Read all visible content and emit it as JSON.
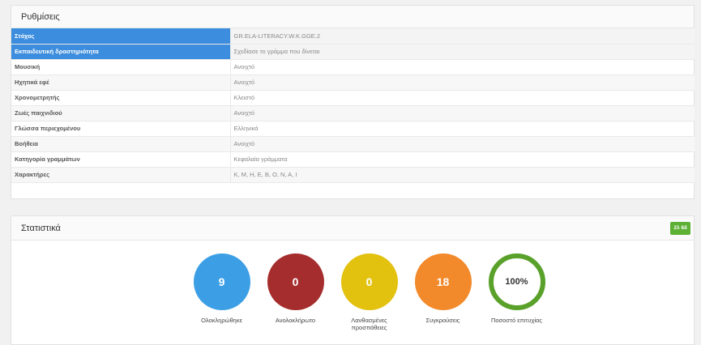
{
  "settings": {
    "title": "Ρυθμίσεις",
    "rows": [
      {
        "label": "Στόχος",
        "value": "GR.ELA-LITERACY.W.K.GGE.2"
      },
      {
        "label": "Εκπαιδευτική δραστηριότητα",
        "value": "Σχεδίασε το γράμμα που δίνεται"
      },
      {
        "label": "Μουσική",
        "value": "Ανοιχτό"
      },
      {
        "label": "Ηχητικά εφέ",
        "value": "Ανοιχτό"
      },
      {
        "label": "Χρονομετρητής",
        "value": "Κλειστό"
      },
      {
        "label": "Ζωές παιχνιδιού",
        "value": "Ανοιχτό"
      },
      {
        "label": "Γλώσσα περιεχομένου",
        "value": "Ελληνικά"
      },
      {
        "label": "Βοήθεια",
        "value": "Ανοιχτό"
      },
      {
        "label": "Κατηγορία γραμμάτων",
        "value": "Κεφαλαία γράμματα"
      },
      {
        "label": "Χαρακτήρες",
        "value": "K, M, H, E, B, O, N, A, I"
      }
    ]
  },
  "statistics": {
    "title": "Στατιστικά",
    "badge": "2λ 6δ",
    "badge_color": "#5cb034",
    "items": [
      {
        "value": "9",
        "label": "Ολοκληρώθηκε",
        "color": "#3c9fe6"
      },
      {
        "value": "0",
        "label": "Ανολοκλήρωτο",
        "color": "#a52d2d"
      },
      {
        "value": "0",
        "label": "Λανθασμένες προσπάθειες",
        "color": "#e3c10f"
      },
      {
        "value": "18",
        "label": "Συγκρούσεις",
        "color": "#f28a2b"
      },
      {
        "value": "100%",
        "label": "Ποσοστό επιτυχίας",
        "color": "#59a12a"
      }
    ]
  }
}
